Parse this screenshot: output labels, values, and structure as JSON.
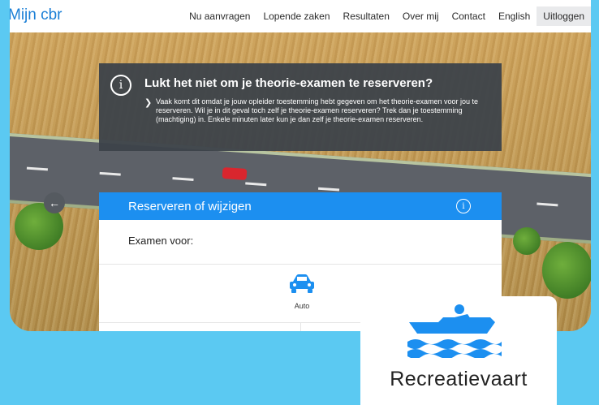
{
  "app": {
    "logo": "Mijn cbr"
  },
  "nav": {
    "items": [
      "Nu aanvragen",
      "Lopende zaken",
      "Resultaten",
      "Over mij",
      "Contact",
      "English"
    ],
    "logout": "Uitloggen"
  },
  "notice": {
    "title": "Lukt het niet om je theorie-examen te reserveren?",
    "body": "Vaak komt dit omdat je jouw opleider toestemming hebt gegeven om het theorie-examen voor jou te reserveren. Wil je in dit geval toch zelf je theorie-examen reserveren? Trek dan je toestemming (machtiging) in. Enkele minuten later kun je dan zelf je theorie-examen reserveren.",
    "icon": "info-icon"
  },
  "card": {
    "title": "Reserveren of wijzigen",
    "exam_for_label": "Examen voor:",
    "options": [
      {
        "label": "Auto",
        "icon": "car-icon"
      }
    ]
  },
  "tile": {
    "label": "Recreatievaart",
    "icon": "boat-icon"
  },
  "colors": {
    "brand": "#1c8ff0",
    "background": "#5bc9f2",
    "notice": "#3c424a"
  }
}
